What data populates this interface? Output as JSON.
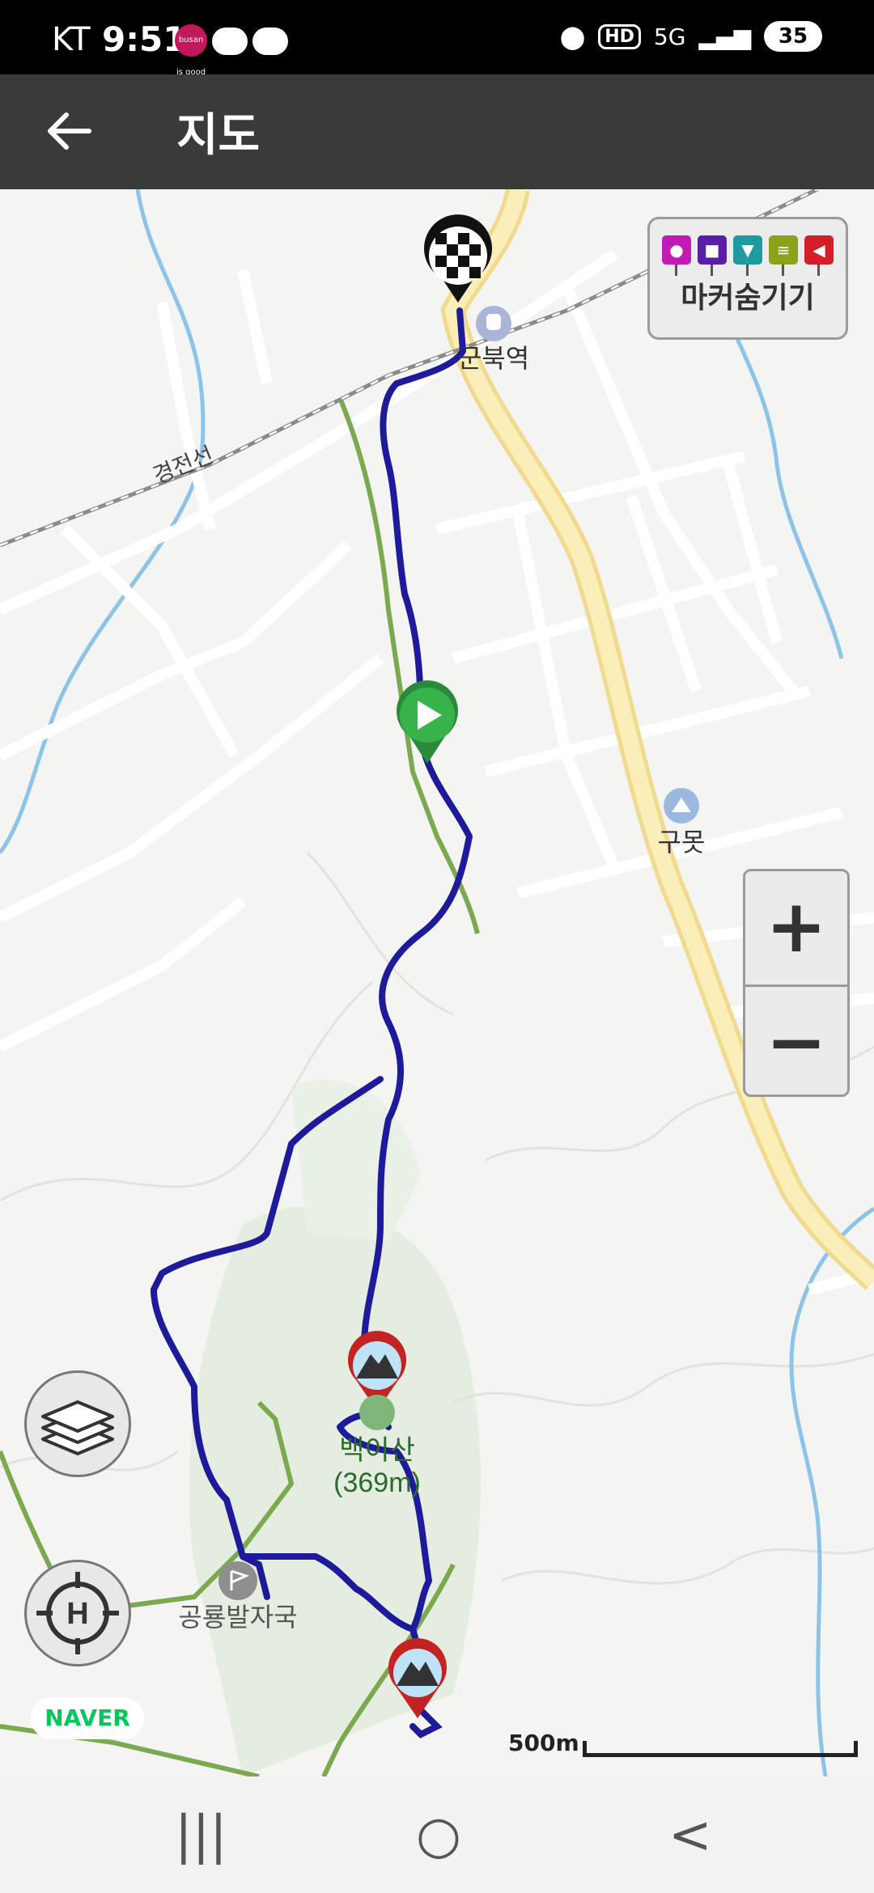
{
  "status_bar": {
    "carrier": "KT",
    "time": "9:51",
    "app_badge": "busan is good",
    "hd": "HD",
    "network": "5G",
    "battery": "35"
  },
  "header": {
    "title": "지도"
  },
  "map": {
    "place_station": "군북역",
    "place_pond": "구못",
    "rail_line": "경전선",
    "peak_name": "백이산",
    "peak_height": "(369m)",
    "landmark": "공룡발자국",
    "scale_label": "500m",
    "attribution": "NAVER"
  },
  "marker_toggle": {
    "label": "마커숨기기",
    "pins": [
      {
        "icon": "camera-icon",
        "color": "#c21bb5"
      },
      {
        "icon": "video-icon",
        "color": "#5a1fa8"
      },
      {
        "icon": "pin-icon",
        "color": "#1e9b9e"
      },
      {
        "icon": "note-icon",
        "color": "#8aa21c"
      },
      {
        "icon": "flag-icon",
        "color": "#d31f2a"
      }
    ]
  },
  "zoom": {
    "in": "+",
    "out": "−"
  },
  "nav": {
    "recent": "|||",
    "home": "○",
    "back": "<"
  },
  "colors": {
    "track": "#1d1a9b",
    "trail": "#6aa84f",
    "road": "#f8e3a1",
    "header": "#3a3a3a"
  }
}
